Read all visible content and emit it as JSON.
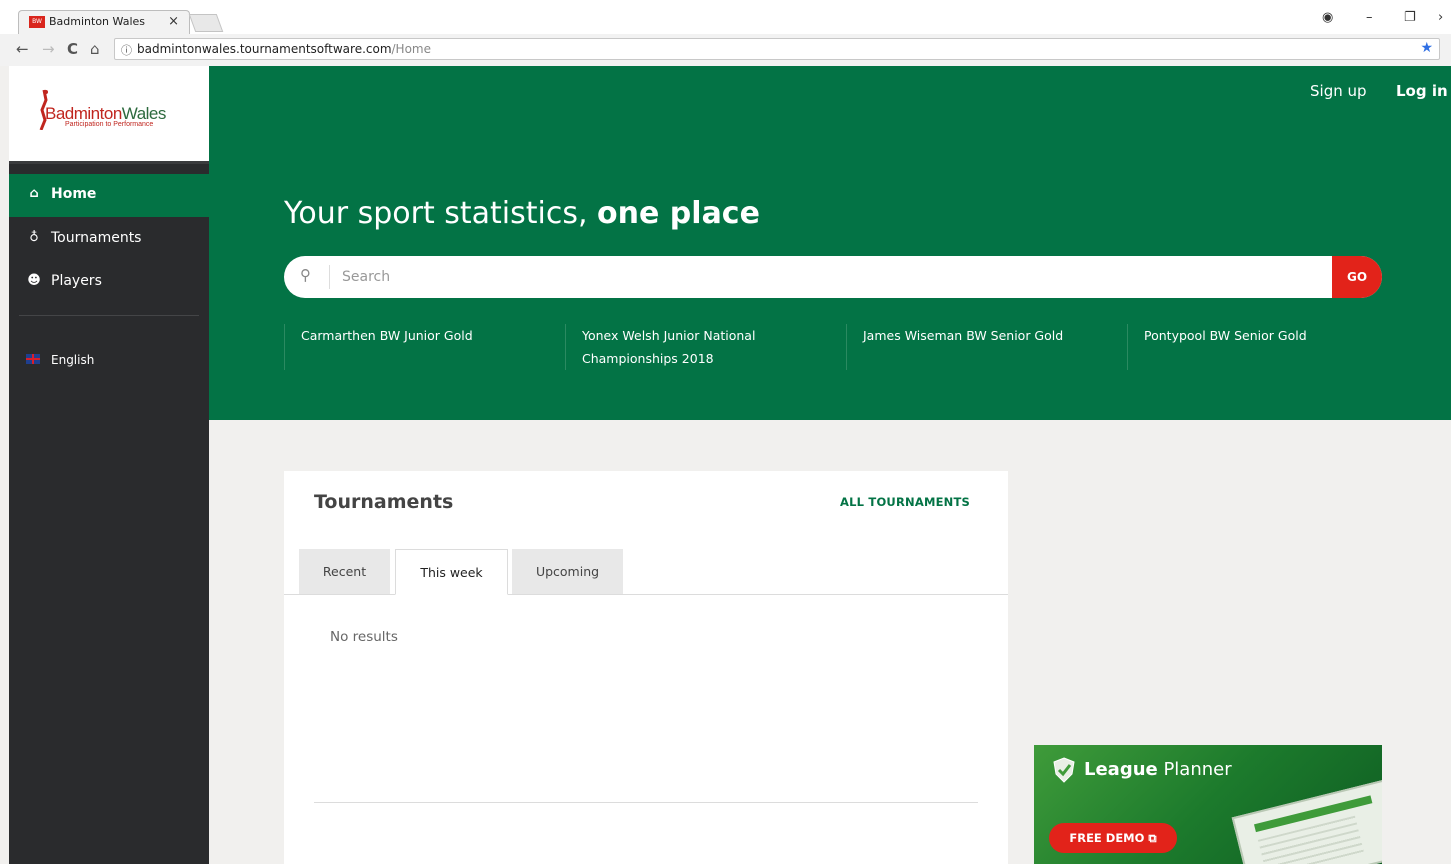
{
  "browser": {
    "tab_title": "Badminton Wales",
    "tab_close": "×",
    "url_host": "badmintonwales.tournamentsoftware.com",
    "url_path": "/Home",
    "back": "←",
    "forward": "→",
    "reload": "C",
    "home": "⌂",
    "info": "ⓘ",
    "star": "★",
    "account": "◉",
    "minimize": "–",
    "restore": "❐",
    "more": "›"
  },
  "sidebar": {
    "logo": {
      "text_left": "Badminton",
      "text_right": "Wales",
      "tagline": "Participation to Performance"
    },
    "items": [
      {
        "label": "Home",
        "icon": "home-icon",
        "glyph": "⌂",
        "active": true
      },
      {
        "label": "Tournaments",
        "icon": "medal-icon",
        "glyph": "♁",
        "active": false
      },
      {
        "label": "Players",
        "icon": "users-icon",
        "glyph": "☻",
        "active": false
      }
    ],
    "language": "English"
  },
  "hero": {
    "sign_up": "Sign up",
    "log_in": "Log in",
    "title_regular": "Your sport statistics, ",
    "title_bold": "one place",
    "search_placeholder": "Search",
    "search_glyph": "⚲",
    "go": "GO",
    "quick_links": [
      "Carmarthen BW Junior Gold",
      "Yonex Welsh Junior National Championships 2018",
      "James Wiseman BW Senior Gold",
      "Pontypool BW Senior Gold"
    ]
  },
  "tournaments": {
    "title": "Tournaments",
    "all_link": "ALL TOURNAMENTS",
    "tabs": [
      {
        "label": "Recent",
        "active": false
      },
      {
        "label": "This week",
        "active": true
      },
      {
        "label": "Upcoming",
        "active": false
      }
    ],
    "empty": "No results"
  },
  "ad": {
    "brand_bold": "League",
    "brand_regular": " Planner",
    "cta": "FREE DEMO ⧉"
  },
  "colors": {
    "brand_green": "#037345",
    "accent_red": "#e2231a",
    "sidebar_bg": "#2a2b2d",
    "page_bg": "#f1f0ee"
  }
}
